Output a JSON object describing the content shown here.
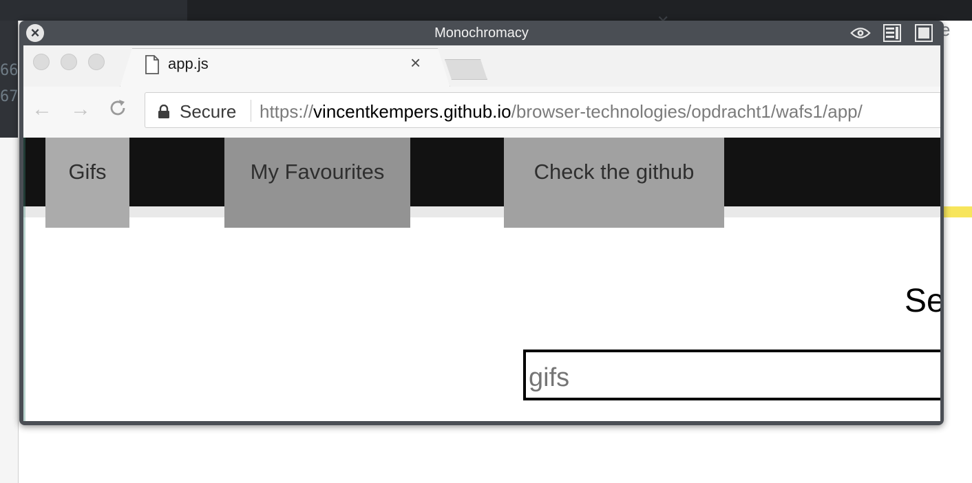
{
  "overlay": {
    "title": "Monochromacy",
    "close_icon": "close-circle-icon",
    "tools": [
      "eye-icon",
      "list-view-icon",
      "window-icon"
    ]
  },
  "browser": {
    "tab_title": "app.js",
    "tab_icon": "file-icon",
    "omnibox": {
      "secure_label": "Secure",
      "url_scheme": "https://",
      "url_host": "vincentkempers.github.io",
      "url_path": "/browser-technologies/opdracht1/wafs1/app/"
    }
  },
  "page": {
    "nav": [
      {
        "label": "Gifs",
        "color": "#ababab"
      },
      {
        "label": "My Favourites",
        "color": "#939393"
      },
      {
        "label": "Check the github",
        "color": "#a1a1a1"
      }
    ],
    "search_title": "Sear",
    "search_placeholder": "gifs"
  },
  "background": {
    "right_text": "e",
    "accent_yellow": "#f7e55c"
  }
}
